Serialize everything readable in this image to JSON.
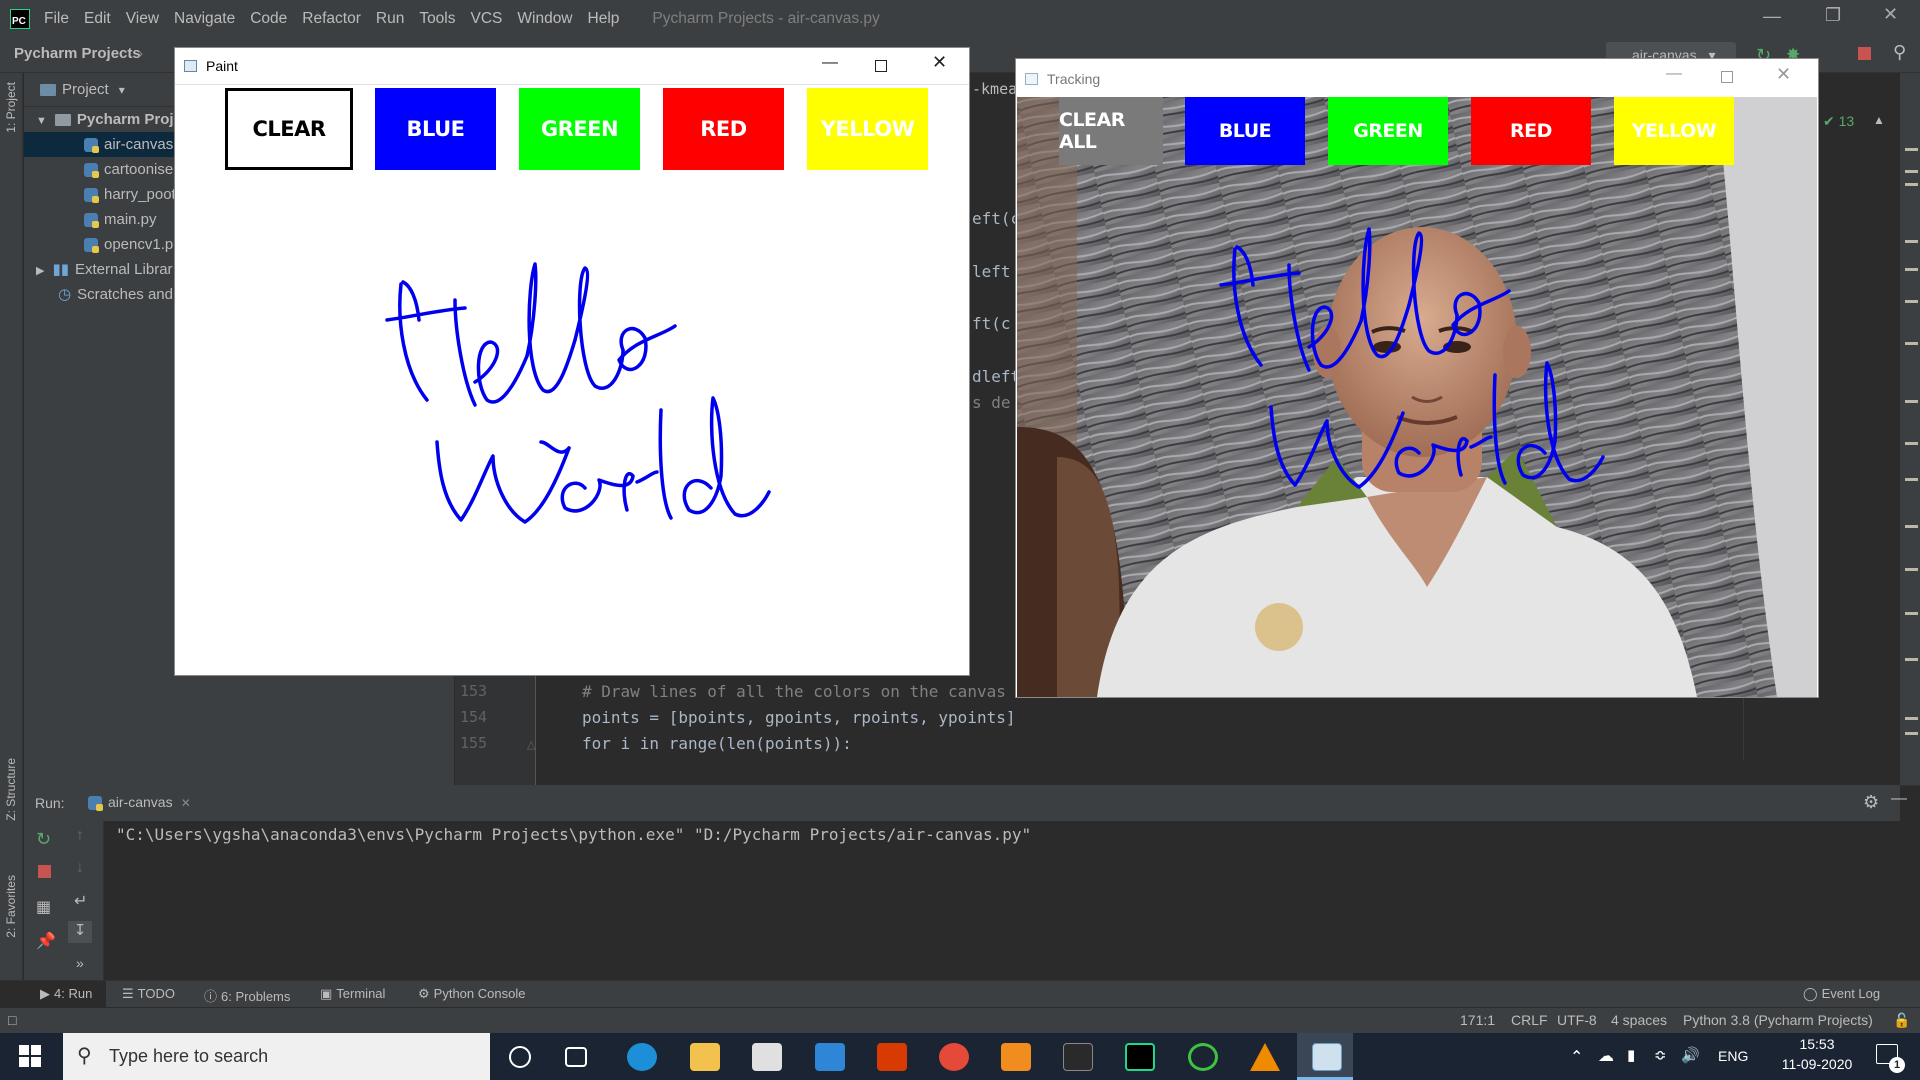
{
  "ide": {
    "logo": "PC",
    "menu": [
      "File",
      "Edit",
      "View",
      "Navigate",
      "Code",
      "Refactor",
      "Run",
      "Tools",
      "VCS",
      "Window",
      "Help"
    ],
    "window_title": "Pycharm Projects - air-canvas.py",
    "breadcrumb": "Pycharm Projects",
    "run_config": "air-canvas",
    "inspection_count": "13"
  },
  "project": {
    "header": "Project",
    "root": "Pycharm Proj",
    "files": [
      "air-canvas.",
      "cartoonise",
      "harry_poot",
      "main.py",
      "opencv1.p"
    ],
    "external": "External Librar",
    "scratches": "Scratches and"
  },
  "editor": {
    "tab_fragment": "-kmear",
    "fragments": [
      "eft(c",
      "left",
      "ft(c",
      "dleft",
      "s de"
    ],
    "lines": [
      {
        "num": "153",
        "text": "# Draw lines of all the colors on the canvas"
      },
      {
        "num": "154",
        "text": "points = [bpoints, gpoints, rpoints, ypoints]"
      },
      {
        "num": "155",
        "text": "for i in range(len(points)):"
      }
    ]
  },
  "run": {
    "label": "Run:",
    "tab": "air-canvas",
    "command": "\"C:\\Users\\ygsha\\anaconda3\\envs\\Pycharm Projects\\python.exe\" \"D:/Pycharm Projects/air-canvas.py\""
  },
  "side_labels": {
    "project": "1: Project",
    "structure": "Z: Structure",
    "favorites": "2: Favorites"
  },
  "tool_tabs": [
    "4: Run",
    "TODO",
    "6: Problems",
    "Terminal",
    "Python Console"
  ],
  "event_log": "Event Log",
  "status": {
    "position": "171:1",
    "line_sep": "CRLF",
    "encoding": "UTF-8",
    "indent": "4 spaces",
    "interpreter": "Python 3.8 (Pycharm Projects)"
  },
  "paint": {
    "title": "Paint",
    "buttons": [
      {
        "label": "CLEAR",
        "bg": "#ffffff",
        "fg": "#000000"
      },
      {
        "label": "BLUE",
        "bg": "#0000ff",
        "fg": "#ffffff"
      },
      {
        "label": "GREEN",
        "bg": "#00ff00",
        "fg": "#ffffff"
      },
      {
        "label": "RED",
        "bg": "#ff0000",
        "fg": "#ffffff"
      },
      {
        "label": "YELLOW",
        "bg": "#ffff00",
        "fg": "#ffffff"
      }
    ],
    "ink_color": "#0000ee"
  },
  "tracking": {
    "title": "Tracking",
    "buttons": [
      {
        "label": "CLEAR ALL",
        "bg": "#7a7a7a",
        "fg": "#ffffff"
      },
      {
        "label": "BLUE",
        "bg": "#0000ff",
        "fg": "#ffffff"
      },
      {
        "label": "GREEN",
        "bg": "#00ff00",
        "fg": "#ffffff"
      },
      {
        "label": "RED",
        "bg": "#ff0000",
        "fg": "#ffffff"
      },
      {
        "label": "YELLOW",
        "bg": "#ffff00",
        "fg": "#ffffff"
      }
    ]
  },
  "taskbar": {
    "search_placeholder": "Type here to search",
    "language": "ENG",
    "time": "15:53",
    "date": "11-09-2020",
    "notification_count": "1",
    "icons": [
      "task-view-icon",
      "edge-icon",
      "file-explorer-icon",
      "store-icon",
      "mail-icon",
      "office-icon",
      "chrome-icon",
      "sublime-icon",
      "terminal-icon",
      "pycharm-icon",
      "spinner-app-icon",
      "vlc-icon",
      "paint-app-icon"
    ]
  }
}
